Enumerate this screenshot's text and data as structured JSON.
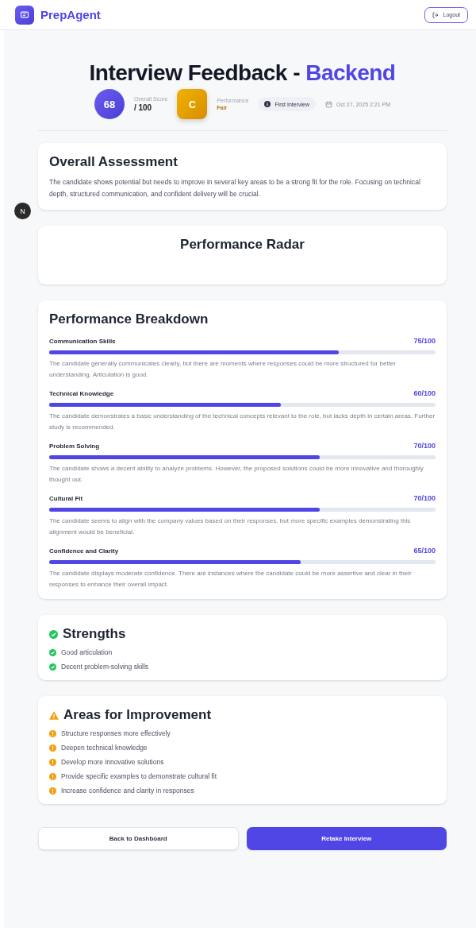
{
  "header": {
    "brand": "PrepAgent",
    "logout": "Logout"
  },
  "dev_badge": "N",
  "title": {
    "prefix": "Interview Feedback -",
    "role": "Backend"
  },
  "summary": {
    "score": "68",
    "score_label": "Overall Score",
    "score_total": "/ 100",
    "grade": "C",
    "performance_label": "Performance",
    "performance": "Fair",
    "interview_tag": "First Interview",
    "date": "Oct 27, 2025 2:21 PM"
  },
  "overall": {
    "title": "Overall Assessment",
    "text": "The candidate shows potential but needs to improve in several key areas to be a strong fit for the role. Focusing on technical depth, structured communication, and confident delivery will be crucial."
  },
  "radar": {
    "title": "Performance Radar"
  },
  "breakdown": {
    "title": "Performance Breakdown",
    "items": [
      {
        "name": "Communication Skills",
        "score": "75/100",
        "level": 0.75,
        "text": "The candidate generally communicates clearly, but there are moments where responses could be more structured for better understanding. Articulation is good."
      },
      {
        "name": "Technical Knowledge",
        "score": "60/100",
        "level": 0.6,
        "text": "The candidate demonstrates a basic understanding of the technical concepts relevant to the role, but lacks depth in certain areas. Further study is recommended."
      },
      {
        "name": "Problem Solving",
        "score": "70/100",
        "level": 0.7,
        "text": "The candidate shows a decent ability to analyze problems. However, the proposed solutions could be more innovative and thoroughly thought out."
      },
      {
        "name": "Cultural Fit",
        "score": "70/100",
        "level": 0.7,
        "text": "The candidate seems to align with the company values based on their responses, but more specific examples demonstrating this alignment would be beneficial."
      },
      {
        "name": "Confidence and Clarity",
        "score": "65/100",
        "level": 0.65,
        "text": "The candidate displays moderate confidence. There are instances where the candidate could be more assertive and clear in their responses to enhance their overall impact."
      }
    ]
  },
  "strengths": {
    "title": "Strengths",
    "items": [
      "Good articulation",
      "Decent problem-solving skills"
    ]
  },
  "improvements": {
    "title": "Areas for Improvement",
    "items": [
      "Structure responses more effectively",
      "Deepen technical knowledge",
      "Develop more innovative solutions",
      "Provide specific examples to demonstrate cultural fit",
      "Increase confidence and clarity in responses"
    ]
  },
  "actions": {
    "back": "Back to Dashboard",
    "retake": "Retake Interview"
  }
}
